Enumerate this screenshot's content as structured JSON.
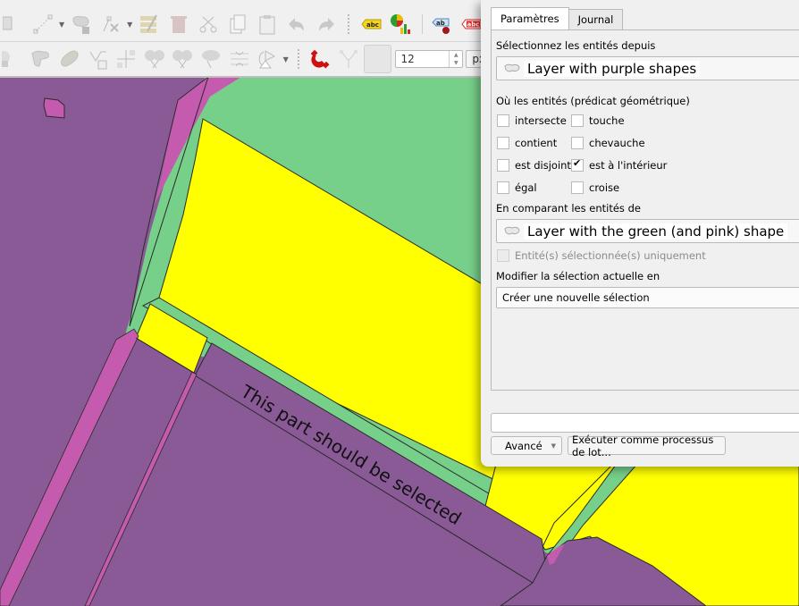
{
  "colors": {
    "purple_layer": "#8a5a96",
    "pink_layer": "#c45bae",
    "green_layer": "#77d08a",
    "yellow_layer": "#ffff00",
    "outline": "#2a2a2a",
    "dialog_bg": "#f0f0f0",
    "magnet_red": "#d01010"
  },
  "toolbar": {
    "row1_icons": [
      "digitize-icon",
      "line-icon",
      "add-polygon-icon",
      "vertex-tool-icon",
      "edit-attributes-icon",
      "delete-icon",
      "cut-icon",
      "copy-icon",
      "paste-icon",
      "undo-icon",
      "redo-icon",
      "label-abc-yellow-icon",
      "diagram-icon",
      "label-pin-icon",
      "label-abc-red-icon"
    ],
    "row2_icons": [
      "delete-part-icon",
      "reshape-icon",
      "offset-curve-icon",
      "vertex-icon",
      "split-feature-icon",
      "split-parts-icon",
      "merge-icon",
      "merge-attributes-icon",
      "rotate-icon",
      "snapping-magnet-icon",
      "topology-icon",
      "snap-type-icon"
    ],
    "tolerance_value": "12",
    "tolerance_unit": "px"
  },
  "map": {
    "annotation": "This part should be selected"
  },
  "dialog": {
    "tabs": [
      {
        "label": "Paramètres",
        "active": true
      },
      {
        "label": "Journal",
        "active": false
      }
    ],
    "source_label": "Sélectionnez les entités depuis",
    "source_layer": "Layer with purple shapes",
    "predicate_label": "Où les entités (prédicat géométrique)",
    "predicates": [
      {
        "label": "intersecte",
        "checked": false
      },
      {
        "label": "touche",
        "checked": false
      },
      {
        "label": "contient",
        "checked": false
      },
      {
        "label": "chevauche",
        "checked": false
      },
      {
        "label": "est disjoint",
        "checked": false
      },
      {
        "label": "est à l'intérieur",
        "checked": true
      },
      {
        "label": "égal",
        "checked": false
      },
      {
        "label": "croise",
        "checked": false
      }
    ],
    "compare_label": "En comparant les entités de",
    "compare_layer": "Layer with the green (and pink) shape",
    "selected_only_label": "Entité(s) sélectionnée(s) uniquement",
    "selected_only_checked": false,
    "modify_label": "Modifier la sélection actuelle en",
    "modify_value": "Créer une nouvelle sélection",
    "progress": 0,
    "advanced_label": "Avancé",
    "batch_label": "Exécuter comme processus de lot..."
  }
}
